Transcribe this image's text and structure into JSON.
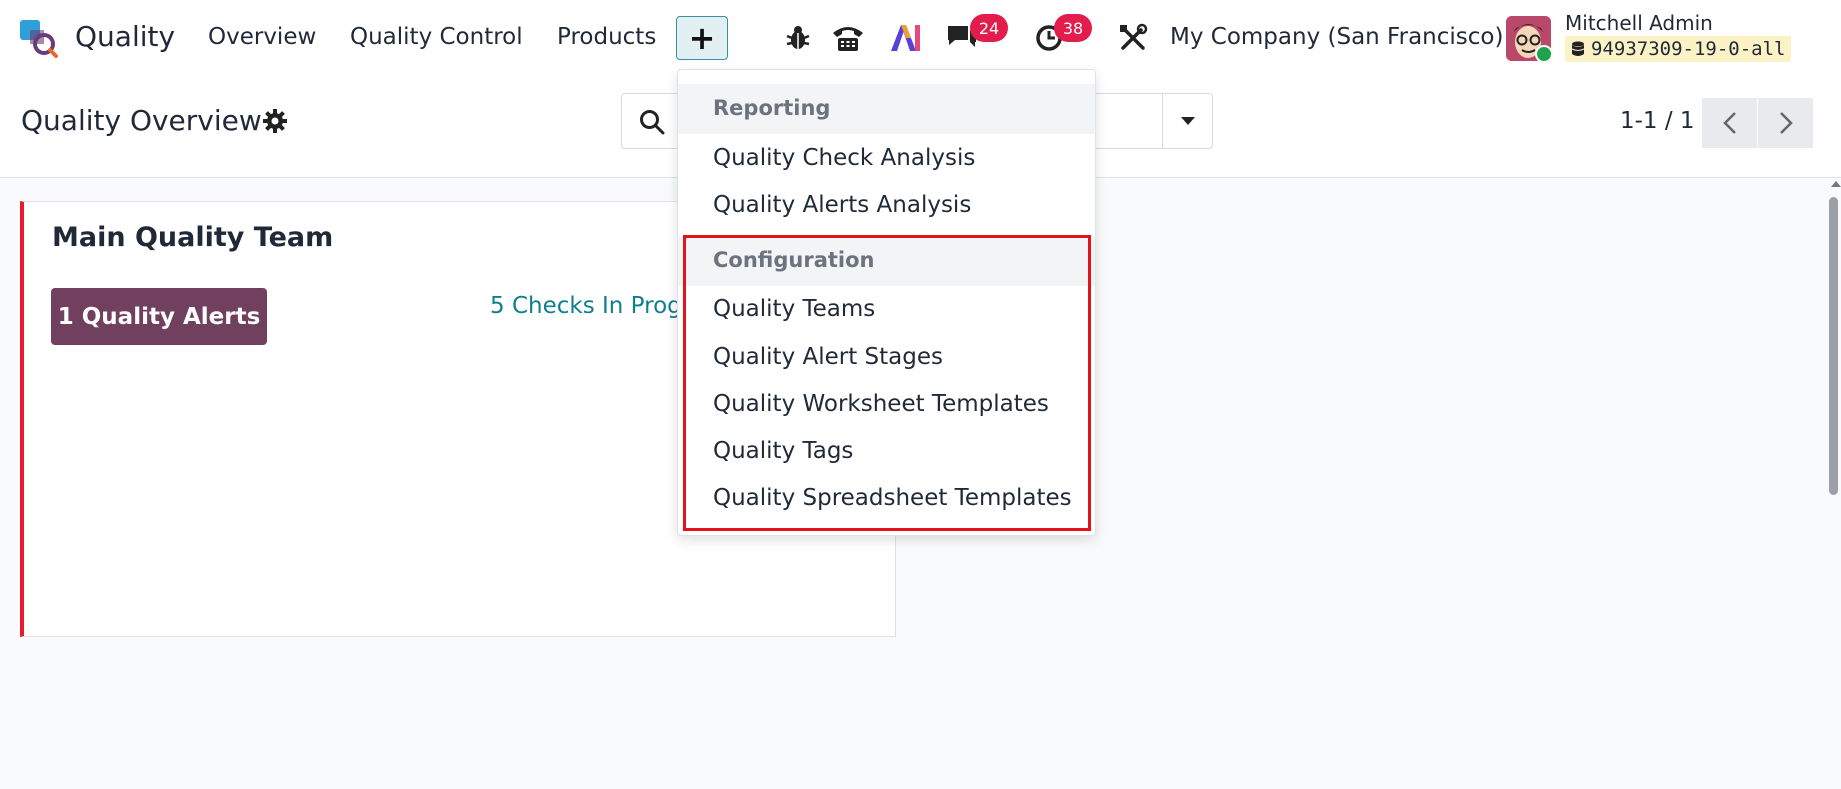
{
  "navbar": {
    "app_name": "Quality",
    "menu": [
      "Overview",
      "Quality Control",
      "Products"
    ],
    "plus_label": "+",
    "messages_badge": "24",
    "activities_badge": "38",
    "company": "My Company (San Francisco)",
    "user_name": "Mitchell Admin",
    "database": "94937309-19-0-all"
  },
  "control_panel": {
    "title": "Quality Overview",
    "pager": "1-1 / 1"
  },
  "team_card": {
    "name": "Main Quality Team",
    "alerts_button": "1 Quality Alerts",
    "checks_link": "5 Checks In Progr"
  },
  "dropdown": {
    "reporting_header": "Reporting",
    "reporting_items": [
      "Quality Check Analysis",
      "Quality Alerts Analysis"
    ],
    "configuration_header": "Configuration",
    "configuration_items": [
      "Quality Teams",
      "Quality Alert Stages",
      "Quality Worksheet Templates",
      "Quality Tags",
      "Quality Spreadsheet Templates"
    ]
  },
  "colors": {
    "brand": "#71405f",
    "badge": "#e31d4b",
    "link": "#107f8c",
    "highlight": "#e3131b"
  },
  "icons": [
    "app-logo-icon",
    "bug-icon",
    "phone-icon",
    "ai-icon",
    "chat-icon",
    "clock-icon",
    "tools-icon",
    "gear-icon",
    "search-icon",
    "caret-down-icon",
    "chevron-left-icon",
    "chevron-right-icon",
    "database-icon"
  ]
}
